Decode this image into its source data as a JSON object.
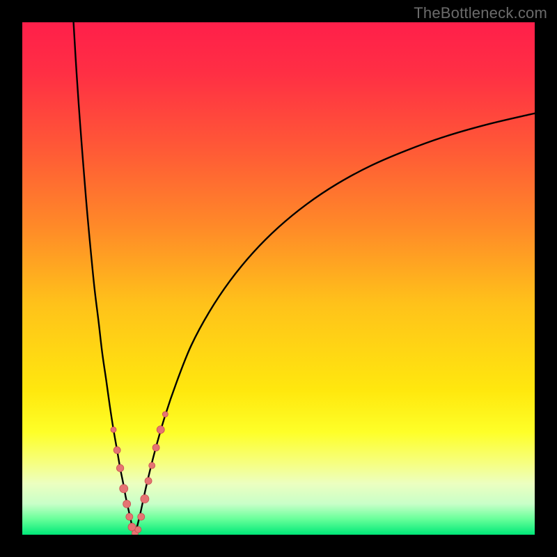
{
  "watermark": "TheBottleneck.com",
  "colors": {
    "gradient_stops": [
      {
        "offset": 0.0,
        "color": "#ff1f4a"
      },
      {
        "offset": 0.1,
        "color": "#ff2f44"
      },
      {
        "offset": 0.25,
        "color": "#ff5a36"
      },
      {
        "offset": 0.4,
        "color": "#ff8a28"
      },
      {
        "offset": 0.55,
        "color": "#ffc21a"
      },
      {
        "offset": 0.72,
        "color": "#ffe80e"
      },
      {
        "offset": 0.8,
        "color": "#feff28"
      },
      {
        "offset": 0.86,
        "color": "#f6ff80"
      },
      {
        "offset": 0.9,
        "color": "#ecffc0"
      },
      {
        "offset": 0.94,
        "color": "#c8ffc8"
      },
      {
        "offset": 0.97,
        "color": "#66ff99"
      },
      {
        "offset": 1.0,
        "color": "#00e878"
      }
    ],
    "curve": "#000000",
    "marker_fill": "#e57373",
    "marker_stroke": "#c94f4f"
  },
  "chart_data": {
    "type": "line",
    "title": "",
    "xlabel": "",
    "ylabel": "",
    "xlim": [
      0,
      100
    ],
    "ylim": [
      0,
      100
    ],
    "grid": false,
    "annotations": [],
    "series": [
      {
        "name": "left-branch",
        "x": [
          10.0,
          10.6,
          11.3,
          12.0,
          12.7,
          13.4,
          14.1,
          14.9,
          15.6,
          16.4,
          17.1,
          17.8,
          18.5,
          19.1,
          19.7,
          20.2,
          20.7,
          21.1,
          21.4,
          21.7,
          22.0
        ],
        "y": [
          100.0,
          90.0,
          80.0,
          71.0,
          62.5,
          55.0,
          48.0,
          41.5,
          35.5,
          30.0,
          25.0,
          20.5,
          16.5,
          13.0,
          10.0,
          7.3,
          5.0,
          3.2,
          1.8,
          0.8,
          0.0
        ]
      },
      {
        "name": "right-branch",
        "x": [
          22.0,
          23.0,
          24.2,
          25.8,
          27.8,
          30.2,
          33.0,
          36.5,
          40.5,
          45.0,
          50.0,
          55.5,
          61.5,
          68.0,
          75.0,
          82.5,
          90.5,
          99.0,
          100.0
        ],
        "y": [
          0.0,
          4.0,
          9.5,
          16.0,
          23.0,
          30.0,
          37.0,
          43.5,
          49.5,
          55.0,
          60.0,
          64.5,
          68.5,
          72.0,
          75.0,
          77.7,
          80.0,
          82.0,
          82.2
        ]
      }
    ],
    "markers": [
      {
        "branch": "left",
        "x": 17.8,
        "y": 20.5,
        "r": 4.0
      },
      {
        "branch": "left",
        "x": 18.5,
        "y": 16.5,
        "r": 5.0
      },
      {
        "branch": "left",
        "x": 19.1,
        "y": 13.0,
        "r": 5.2
      },
      {
        "branch": "left",
        "x": 19.8,
        "y": 9.0,
        "r": 6.0
      },
      {
        "branch": "left",
        "x": 20.4,
        "y": 6.0,
        "r": 5.5
      },
      {
        "branch": "left",
        "x": 20.9,
        "y": 3.5,
        "r": 5.0
      },
      {
        "branch": "left",
        "x": 21.4,
        "y": 1.5,
        "r": 5.5
      },
      {
        "branch": "left",
        "x": 22.0,
        "y": 0.3,
        "r": 4.5
      },
      {
        "branch": "right",
        "x": 22.6,
        "y": 1.0,
        "r": 4.5
      },
      {
        "branch": "right",
        "x": 23.2,
        "y": 3.5,
        "r": 5.0
      },
      {
        "branch": "right",
        "x": 23.9,
        "y": 7.0,
        "r": 6.0
      },
      {
        "branch": "right",
        "x": 24.6,
        "y": 10.5,
        "r": 5.0
      },
      {
        "branch": "right",
        "x": 25.3,
        "y": 13.5,
        "r": 4.5
      },
      {
        "branch": "right",
        "x": 26.1,
        "y": 17.0,
        "r": 5.0
      },
      {
        "branch": "right",
        "x": 27.0,
        "y": 20.5,
        "r": 5.5
      },
      {
        "branch": "right",
        "x": 27.9,
        "y": 23.5,
        "r": 4.0
      }
    ],
    "minimum_x": 22.0
  }
}
